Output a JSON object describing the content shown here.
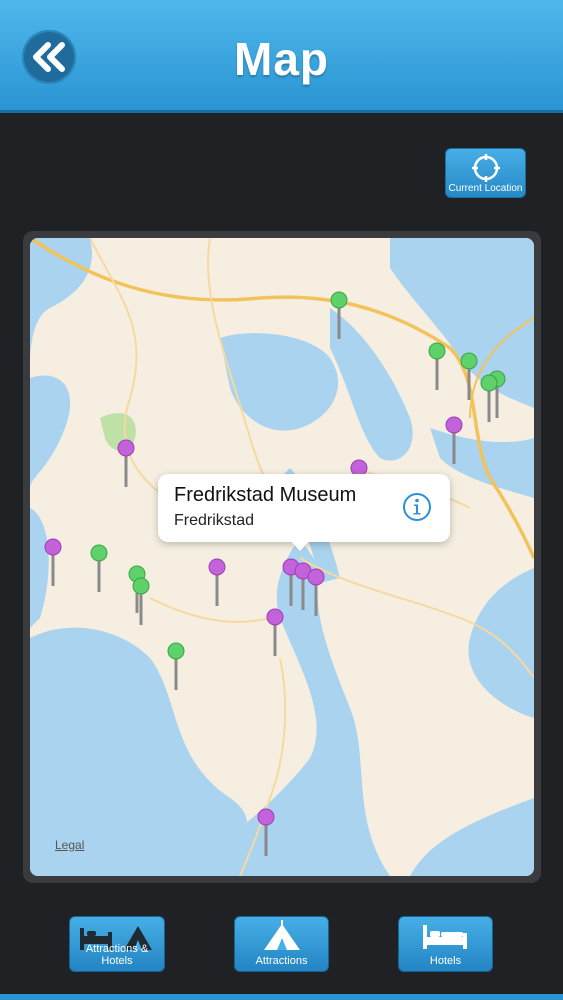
{
  "header": {
    "title": "Map"
  },
  "current_location": {
    "label": "Current Location"
  },
  "map": {
    "callout": {
      "title": "Fredrikstad Museum",
      "subtitle": "Fredrikstad"
    },
    "legal_label": "Legal",
    "pin_colors": {
      "attraction": "#5fd16a",
      "hotel": "#c462db"
    }
  },
  "tabs": [
    {
      "label": "Attractions & Hotels",
      "icon": "bed-and-tent-icon"
    },
    {
      "label": "Attractions",
      "icon": "tent-icon"
    },
    {
      "label": "Hotels",
      "icon": "bed-icon"
    }
  ],
  "colors": {
    "accent": "#2a95d3",
    "water": "#a9d3ee",
    "land": "#f6efe1",
    "road": "#f3c35b"
  }
}
